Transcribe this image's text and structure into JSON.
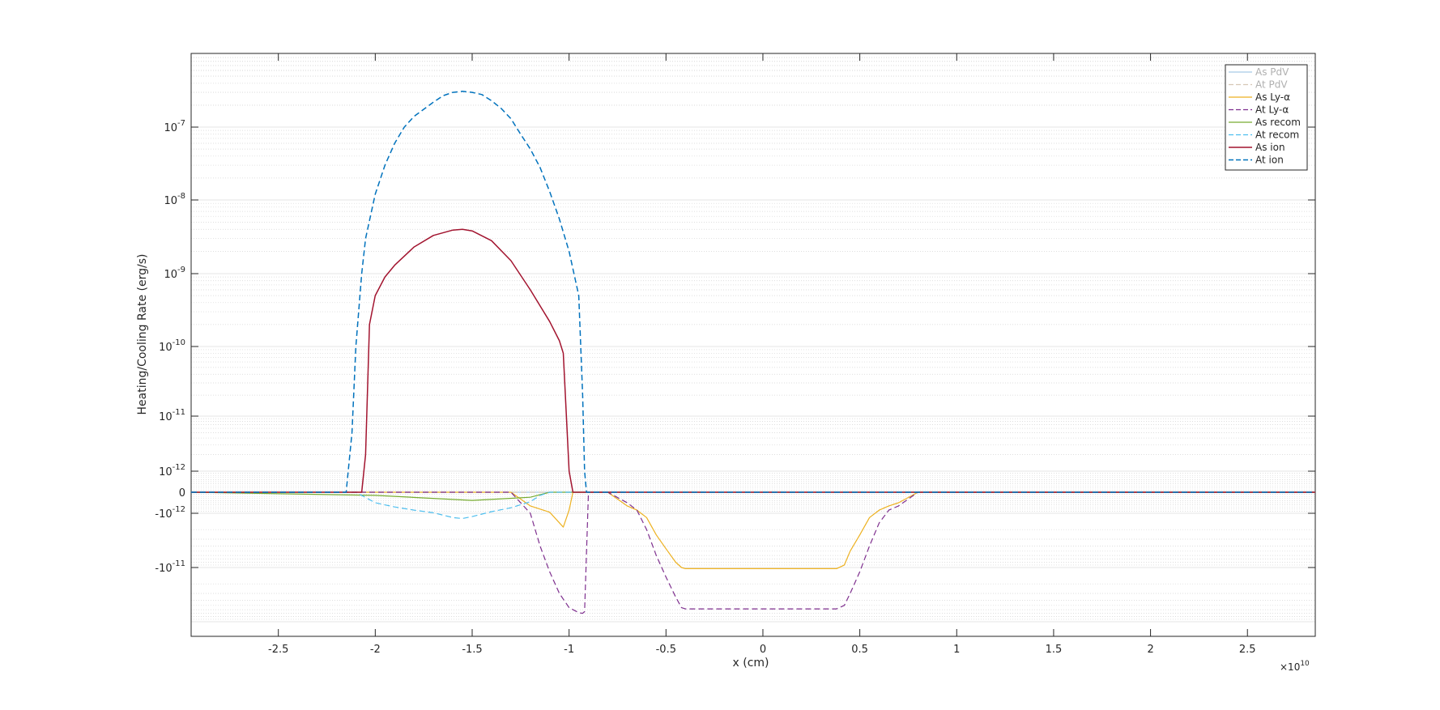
{
  "chart_data": {
    "type": "line",
    "xlabel": "x (cm)",
    "ylabel": "Heating/Cooling Rate (erg/s)",
    "x_exponent_label": "×10",
    "x_exponent": "10",
    "xlim": [
      -2.95,
      2.85
    ],
    "x_ticks": [
      -2.5,
      -2,
      -1.5,
      -1,
      -0.5,
      0,
      0.5,
      1,
      1.5,
      2,
      2.5
    ],
    "x_tick_labels": [
      "-2.5",
      "-2",
      "-1.5",
      "-1",
      "-0.5",
      "0",
      "0.5",
      "1",
      "1.5",
      "2",
      "2.5"
    ],
    "y_scale": "symlog",
    "y_tick_labels": [
      {
        "value": 1e-07,
        "base": "10",
        "exp": "-7"
      },
      {
        "value": 1e-08,
        "base": "10",
        "exp": "-8"
      },
      {
        "value": 1e-09,
        "base": "10",
        "exp": "-9"
      },
      {
        "value": 1e-10,
        "base": "10",
        "exp": "-10"
      },
      {
        "value": 1e-11,
        "base": "10",
        "exp": "-11"
      },
      {
        "value": 1e-12,
        "base": "10",
        "exp": "-12"
      },
      {
        "value": 0,
        "base": "0",
        "exp": ""
      },
      {
        "value": -1e-12,
        "base": "-10",
        "exp": "-12"
      },
      {
        "value": -1e-11,
        "base": "-10",
        "exp": "-11"
      }
    ],
    "grid": true,
    "legend_position": "top-right",
    "series": [
      {
        "name": "As PdV",
        "color": "#a8c9e8",
        "dash": "solid",
        "width": 1.2,
        "x": [
          -2.95,
          2.85
        ],
        "y": [
          0,
          0
        ]
      },
      {
        "name": "At PdV",
        "color": "#d6c8b5",
        "dash": "dashed",
        "width": 1.2,
        "x": [
          -2.95,
          2.85
        ],
        "y": [
          0,
          0
        ]
      },
      {
        "name": "As Ly-α",
        "color": "#edb120",
        "dash": "solid",
        "width": 1.2,
        "x": [
          -2.95,
          -1.3,
          -1.2,
          -1.15,
          -1.1,
          -1.05,
          -1.03,
          -1.0,
          -0.98,
          -0.95,
          -0.8,
          -0.7,
          -0.65,
          -0.6,
          -0.55,
          -0.5,
          -0.45,
          -0.42,
          -0.4,
          0.38,
          0.42,
          0.45,
          0.5,
          0.55,
          0.6,
          0.65,
          0.7,
          0.8,
          2.85
        ],
        "y": [
          0,
          0,
          -2e-13,
          -4e-13,
          -8e-13,
          -1.5e-12,
          -1.8e-12,
          -5e-13,
          0,
          0,
          0,
          -2e-13,
          -5e-13,
          -1.2e-12,
          -2.5e-12,
          -4.5e-12,
          -8e-12,
          -1e-11,
          -1.05e-11,
          -1.05e-11,
          -9e-12,
          -5e-12,
          -2.5e-12,
          -1.2e-12,
          -5e-13,
          -2e-13,
          -1e-13,
          0,
          0
        ]
      },
      {
        "name": "At Ly-α",
        "color": "#7e2f8e",
        "dash": "dashed",
        "width": 1.2,
        "x": [
          -2.95,
          -1.3,
          -1.2,
          -1.15,
          -1.1,
          -1.05,
          -1.0,
          -0.95,
          -0.93,
          -0.92,
          -0.9,
          -0.85,
          -0.8,
          -0.7,
          -0.65,
          -0.6,
          -0.55,
          -0.5,
          -0.45,
          -0.42,
          -0.4,
          0.38,
          0.42,
          0.45,
          0.5,
          0.55,
          0.6,
          0.65,
          0.7,
          0.8,
          2.85
        ],
        "y": [
          0,
          0,
          -1e-12,
          -4e-12,
          -1.2e-11,
          -3e-11,
          -5.5e-11,
          -6.8e-11,
          -7e-11,
          -6.5e-11,
          0,
          0,
          0,
          -1e-13,
          -5e-13,
          -2e-12,
          -6e-12,
          -1.5e-11,
          -3.5e-11,
          -5.5e-11,
          -5.8e-11,
          -5.8e-11,
          -5e-11,
          -3e-11,
          -1.2e-11,
          -4e-12,
          -1.5e-12,
          -5e-13,
          -2e-13,
          0,
          0
        ]
      },
      {
        "name": "As recom",
        "color": "#77ac30",
        "dash": "solid",
        "width": 1.2,
        "x": [
          -2.95,
          -2.0,
          -1.5,
          -1.2,
          -1.1,
          -0.95,
          2.85
        ],
        "y": [
          0,
          -2e-14,
          -6e-14,
          -3e-14,
          -1e-14,
          0,
          0
        ]
      },
      {
        "name": "At recom",
        "color": "#4dbeee",
        "dash": "dashed",
        "width": 1.2,
        "x": [
          -2.95,
          -2.1,
          -2.0,
          -1.9,
          -1.8,
          -1.7,
          -1.6,
          -1.55,
          -1.5,
          -1.4,
          -1.3,
          -1.2,
          -1.15,
          -1.1,
          2.85
        ],
        "y": [
          0,
          0,
          -1e-13,
          -2.5e-13,
          -5e-13,
          -9e-13,
          -1.2e-12,
          -1.25e-12,
          -1.15e-12,
          -7e-13,
          -3e-13,
          -8e-14,
          -2e-14,
          0,
          0
        ]
      },
      {
        "name": "As ion",
        "color": "#a2142f",
        "dash": "solid",
        "width": 1.5,
        "x": [
          -2.95,
          -2.07,
          -2.05,
          -2.03,
          -2.0,
          -1.95,
          -1.9,
          -1.8,
          -1.7,
          -1.6,
          -1.55,
          -1.5,
          -1.4,
          -1.3,
          -1.2,
          -1.1,
          -1.05,
          -1.03,
          -1.0,
          -0.98,
          2.85
        ],
        "y": [
          0,
          0,
          2e-12,
          2e-10,
          5e-10,
          9e-10,
          1.3e-09,
          2.3e-09,
          3.3e-09,
          3.9e-09,
          4e-09,
          3.8e-09,
          2.8e-09,
          1.5e-09,
          6e-10,
          2.2e-10,
          1.2e-10,
          8e-11,
          1e-12,
          0,
          0
        ]
      },
      {
        "name": "At ion",
        "color": "#0072bd",
        "dash": "dashed",
        "width": 1.5,
        "x": [
          -2.95,
          -2.15,
          -2.12,
          -2.1,
          -2.07,
          -2.05,
          -2.0,
          -1.95,
          -1.9,
          -1.85,
          -1.8,
          -1.7,
          -1.65,
          -1.6,
          -1.55,
          -1.5,
          -1.45,
          -1.4,
          -1.35,
          -1.3,
          -1.25,
          -1.2,
          -1.15,
          -1.1,
          -1.05,
          -1.0,
          -0.95,
          -0.93,
          -0.92,
          -0.91,
          2.85
        ],
        "y": [
          0,
          0,
          5e-12,
          1e-10,
          1e-09,
          3e-09,
          1.2e-08,
          3e-08,
          6e-08,
          1e-07,
          1.4e-07,
          2.2e-07,
          2.7e-07,
          3e-07,
          3.1e-07,
          3e-07,
          2.8e-07,
          2.3e-07,
          1.8e-07,
          1.3e-07,
          8e-08,
          5e-08,
          2.8e-08,
          1.3e-08,
          5.5e-09,
          2e-09,
          5e-10,
          2e-11,
          1e-12,
          0,
          0
        ]
      }
    ]
  }
}
